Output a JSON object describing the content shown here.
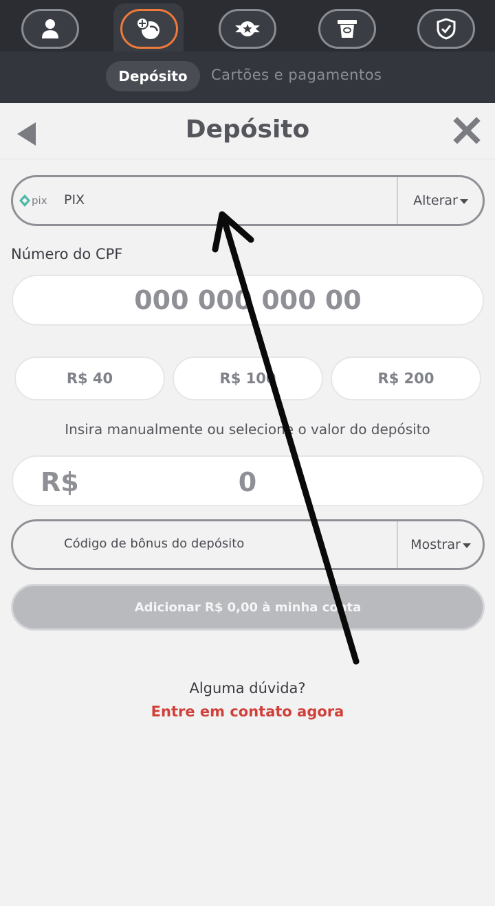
{
  "nav": {
    "icons": [
      "user-icon",
      "wallet-icon",
      "star-badge-icon",
      "cashout-icon",
      "shield-check-icon"
    ],
    "active_index": 1,
    "accent_color": "#f07a3a"
  },
  "subtabs": {
    "active": "Depósito",
    "other": "Cartões e pagamentos"
  },
  "header": {
    "title": "Depósito"
  },
  "method": {
    "logo_text": "pix",
    "label": "PIX",
    "change_label": "Alterar"
  },
  "cpf": {
    "label": "Número do CPF",
    "placeholder": "000 000 000 00"
  },
  "amounts": [
    "R$ 40",
    "R$ 100",
    "R$ 200"
  ],
  "hint": "Insira manualmente ou selecione o valor do depósito",
  "value": {
    "currency": "R$",
    "amount": "0"
  },
  "bonus": {
    "label": "Código de bônus do depósito",
    "toggle_label": "Mostrar"
  },
  "submit": {
    "label": "Adicionar R$ 0,00 à minha conta"
  },
  "help": {
    "question": "Alguma dúvida?",
    "link": "Entre em contato agora",
    "link_color": "#d0403a"
  }
}
